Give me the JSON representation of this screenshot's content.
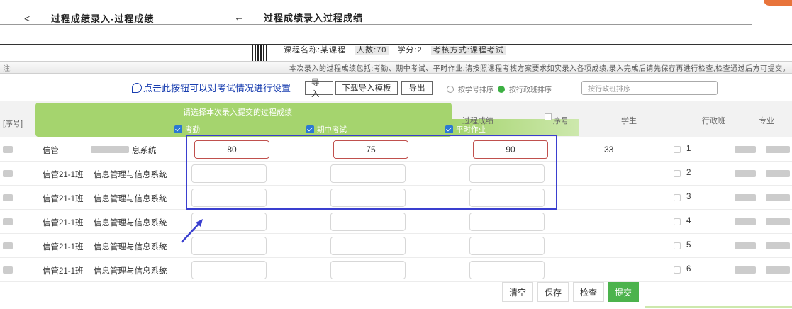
{
  "header": {
    "back_symbol": "<",
    "title_left": "过程成绩录入-过程成绩",
    "back_arrow": "←",
    "title_center": "过程成绩录入过程成绩"
  },
  "info": {
    "line1": [
      "课程名称:某课程",
      "人数:70",
      "学分:2",
      "考核方式:课程考试"
    ],
    "line2": "本次录入的过程成绩包括:考勤、期中考试、平时作业,请按照课程考核方案要求如实录入各项成绩,录入完成后请先保存再进行检查,检查通过后方可提交。",
    "line2_left": "注:"
  },
  "toolbar": {
    "hint": "点击此按钮可以对考试情况进行设置",
    "import_label": "导入",
    "template_label": "下载导入模板",
    "export_label": "导出",
    "sort_by_id": "按学号排序",
    "sort_by_class": "按行政班排序",
    "sort_box_text": "按行政班排序"
  },
  "popup": {
    "title": "请选择本次录入提交的过程成绩",
    "options": [
      "考勤",
      "期中考试",
      "平时作业"
    ]
  },
  "table": {
    "headers": {
      "left": "[序号]",
      "process": "过程成绩",
      "seq": "序号",
      "student": "学生",
      "class": "行政班",
      "major": "专业"
    },
    "rows": [
      {
        "class_name": "信管",
        "major": "息系统",
        "scores": [
          "80",
          "75",
          "90"
        ],
        "extra": "33",
        "seq": "1"
      },
      {
        "class_name": "信管21-1班",
        "major": "信息管理与信息系统",
        "scores": [
          "",
          "",
          ""
        ],
        "extra": "",
        "seq": "2"
      },
      {
        "class_name": "信管21-1班",
        "major": "信息管理与信息系统",
        "scores": [
          "",
          "",
          ""
        ],
        "extra": "",
        "seq": "3"
      },
      {
        "class_name": "信管21-1班",
        "major": "信息管理与信息系统",
        "scores": [
          "",
          "",
          ""
        ],
        "extra": "",
        "seq": "4"
      },
      {
        "class_name": "信管21-1班",
        "major": "信息管理与信息系统",
        "scores": [
          "",
          "",
          ""
        ],
        "extra": "",
        "seq": "5"
      },
      {
        "class_name": "信管21-1班",
        "major": "信息管理与信息系统",
        "scores": [
          "",
          "",
          ""
        ],
        "extra": "",
        "seq": "6"
      }
    ]
  },
  "footer": {
    "clear_label": "清空",
    "save_label": "保存",
    "check_label": "检查",
    "submit_label": "提交"
  },
  "colors": {
    "accent_green": "#4cb34d",
    "popup_green": "#a5d46e",
    "highlight_blue": "#3a3fcf",
    "score_border": "#c0504d"
  }
}
